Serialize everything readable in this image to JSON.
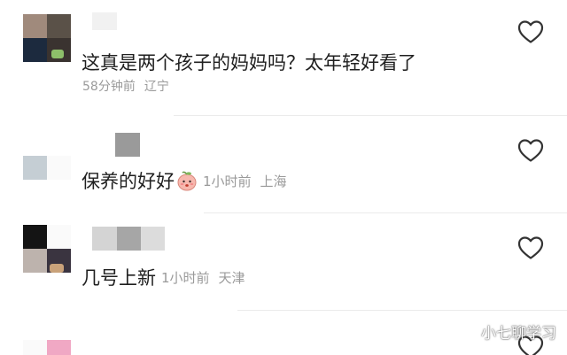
{
  "comments": [
    {
      "text": "这真是两个孩子的妈妈吗？太年轻好看了",
      "time": "58分钟前",
      "location": "辽宁"
    },
    {
      "text": "保养的好好",
      "emoji": "peach-face-emoji",
      "time": "1小时前",
      "location": "上海"
    },
    {
      "text": "几号上新",
      "time": "1小时前",
      "location": "天津"
    }
  ],
  "icons": {
    "like": "heart-outline-icon"
  },
  "colors": {
    "text": "#1f1f1f",
    "meta": "#9a9a9a",
    "divider": "#ebebeb"
  },
  "watermark": "小七聊学习"
}
